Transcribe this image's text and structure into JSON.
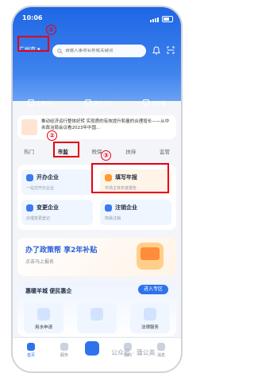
{
  "status": {
    "time": "10:06"
  },
  "header": {
    "city": "广州市",
    "search_placeholder": "请输入事项名称或关键词"
  },
  "quick_links": [
    {
      "label": "办事中心"
    },
    {
      "label": "数字空间"
    },
    {
      "label": "关怀版"
    }
  ],
  "news": {
    "title": "推动经济运行整体好转 实现质的有效提升和量的合理增长——从中央政治局会议看2023年中国..."
  },
  "tabs": [
    {
      "label": "热门"
    },
    {
      "label": "市监"
    },
    {
      "label": "税保"
    },
    {
      "label": "扶持"
    },
    {
      "label": "监管"
    }
  ],
  "services": [
    {
      "name": "开办企业",
      "sub": "一站式开办企业"
    },
    {
      "name": "填写年报",
      "sub": "市场主体年度报告"
    },
    {
      "name": "变更企业",
      "sub": "办理变更登记"
    },
    {
      "name": "注销企业",
      "sub": "简易注销"
    }
  ],
  "promo": {
    "title": "办了政策帮  享2年补贴",
    "subtitle": "点击马上报名"
  },
  "zone": {
    "title": "惠暖羊城 便民惠企",
    "enter_label": "进入专区",
    "subtitle": "",
    "tiles": [
      {
        "label": "用水申请"
      },
      {
        "label": ""
      },
      {
        "label": "法律服务"
      }
    ]
  },
  "annotations": [
    "①",
    "②",
    "③"
  ],
  "nav": [
    {
      "label": "首页"
    },
    {
      "label": "服务"
    },
    {
      "label": ""
    },
    {
      "label": "我的"
    },
    {
      "label": "消息"
    }
  ],
  "watermark": "公众号 · 蒲公英"
}
